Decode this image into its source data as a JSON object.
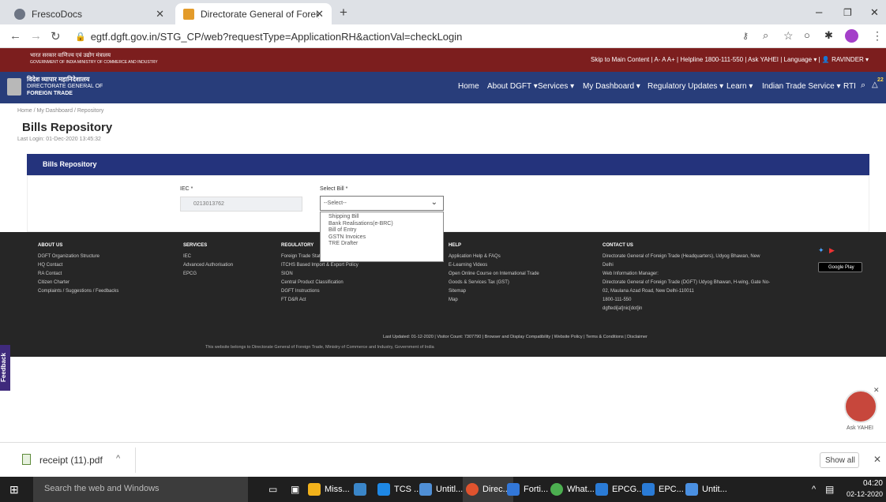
{
  "browser": {
    "tabs": [
      {
        "title": "FrescoDocs",
        "icon": "globe-icon"
      },
      {
        "title": "Directorate General of Foreign Tr",
        "icon": "emblem-icon"
      }
    ],
    "new_tab": "+",
    "url": "egtf.dgft.gov.in/STG_CP/web?requestType=ApplicationRH&actionVal=checkLogin",
    "window_controls": {
      "minimize": "–",
      "maximize": "❐",
      "close": "✕"
    }
  },
  "site": {
    "gov_line": "भारत सरकार  वाणिज्य एवं उद्योग मंत्रालय",
    "gov_line_en": "GOVERNMENT OF INDIA   MINISTRY OF COMMERCE AND INDUSTRY",
    "top_links": "Skip to Main Content  |  A-  A  A+  |  Helpline 1800-111-550  |  Ask YAHEI  |  Language  ▾  |  👤 RAVINDER  ▾",
    "logo_hi": "विदेश व्यापार महानिदेशालय",
    "logo_en1": "DIRECTORATE GENERAL OF",
    "logo_en2": "FOREIGN TRADE",
    "menu": [
      "Home",
      "About DGFT ▾",
      "Services ▾",
      "My Dashboard ▾",
      "Regulatory Updates ▾",
      "Learn ▾",
      "Indian Trade Service ▾",
      "RTI"
    ],
    "notif_count": "22"
  },
  "page": {
    "breadcrumb": "Home  /  My Dashboard  /  Repository",
    "title": "Bills Repository",
    "last_login": "Last Login: 01-Dec-2020 13:45:32",
    "panel_title": "Bills Repository",
    "iec_label": "IEC *",
    "iec_value": "0213013762",
    "select_label": "Select Bill *",
    "select_value": "--Select--",
    "options": [
      "Shipping Bill",
      "Bank Realisations(e-BRC)",
      "Bill of Entry",
      "GSTN Invoices",
      "TRE Drafter"
    ]
  },
  "footer": {
    "about": {
      "head": "ABOUT US",
      "items": [
        "DGFT Organization Structure",
        "HQ Contact",
        "RA Contact",
        "Citizen Charter",
        "Complaints / Suggestions / Feedbacks"
      ]
    },
    "services": {
      "head": "SERVICES",
      "items": [
        "IEC",
        "Advanced Authorisation",
        "EPCG"
      ]
    },
    "regulatory": {
      "head": "REGULATORY",
      "items": [
        "Foreign Trade Statement",
        "ITCHS Based Import & Export Policy",
        "SION",
        "Central Product Classification",
        "DGFT Instructions",
        "FT D&R Act"
      ]
    },
    "help": {
      "head": "HELP",
      "items": [
        "Application Help & FAQs",
        "E-Learning Videos",
        "Open Online Course on International Trade",
        "Goods & Services Tax (GST)",
        "Sitemap",
        "Map"
      ]
    },
    "contact": {
      "head": "CONTACT US",
      "items": [
        "Directorate General of Foreign Trade (Headquarters), Udyog Bhawan, New",
        "Delhi",
        "Web Information Manager:",
        "Directorate General of Foreign Trade (DGFT) Udyog Bhawan, H-wing, Gate No-",
        "02, Maulana Azad Road, New Delhi-110011",
        "1800-111-550",
        "dgftedi[at]nic[dot]in"
      ]
    },
    "bottom_links": "Last Updated: 01-12-2020  |  Visitor Count: 7307790  |  Browser and Display Compatibility  |  Website Policy  |  Terms & Conditions  |  Disclaimer",
    "ownership": "This website belongs to Directorate General of Foreign Trade, Ministry of Commerce and Industry, Government of India",
    "store": "Google Play"
  },
  "feedback": "Feedback",
  "ask_yahei": "Ask YAHEI",
  "downloads": {
    "file": "receipt (11).pdf",
    "show_all": "Show all"
  },
  "taskbar": {
    "search": "Search the web and Windows",
    "apps": [
      "Miss...",
      "TCS ...",
      "Untitl...",
      "Direc...",
      "Forti...",
      "What...",
      "EPCG...",
      "EPC...",
      "Untit..."
    ],
    "time": "04:20",
    "date": "02-12-2020"
  }
}
